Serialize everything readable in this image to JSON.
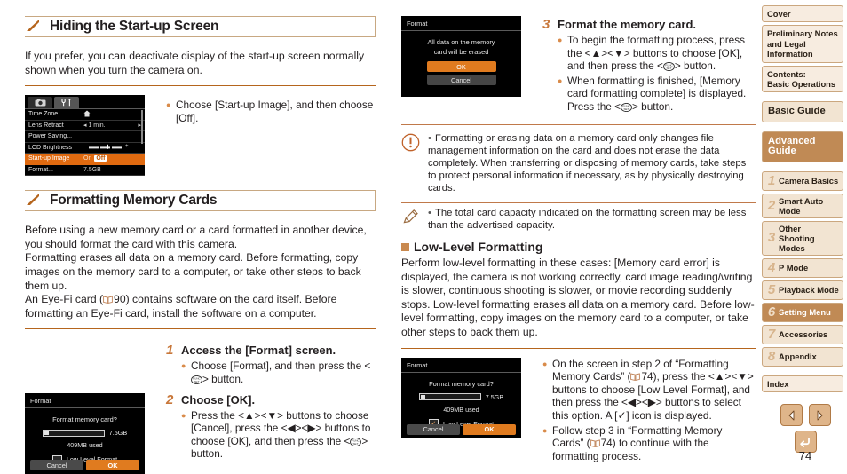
{
  "page": {
    "number": "74"
  },
  "left_column": {
    "section1": {
      "heading": "Hiding the Start-up Screen",
      "intro": "If you prefer, you can deactivate display of the start-up screen normally shown when you turn the camera on.",
      "screen": {
        "tabs": [
          "camera-icon",
          "wrench-tools-icon"
        ],
        "rows": [
          {
            "label": "Time Zone...",
            "value": "home-icon"
          },
          {
            "label": "Lens Retract",
            "value": "1 min."
          },
          {
            "label": "Power Saving...",
            "value": ""
          },
          {
            "label": "LCD Brightness",
            "value": "slider"
          },
          {
            "label": "Start-up Image",
            "value_on": "On",
            "value_off": "Off",
            "selected": true
          },
          {
            "label": "Format...",
            "value": "7.5GB"
          }
        ]
      },
      "bullets": [
        "Choose [Start-up Image], and then choose [Off]."
      ]
    },
    "section2": {
      "heading": "Formatting Memory Cards",
      "paragraphs": [
        "Before using a new memory card or a card formatted in another device, you should format the card with this camera.",
        "Formatting erases all data on a memory card. Before formatting, copy images on the memory card to a computer, or take other steps to back them up.",
        "An Eye-Fi card (—90) contains software on the card itself. Before formatting an Eye-Fi card, install the software on a computer."
      ],
      "eyefi_page_ref": "90",
      "step1": {
        "number": "1",
        "title": "Access the [Format] screen.",
        "bullets": [
          {
            "pre": "Choose [Format], and then press the <",
            "post": "> button."
          }
        ]
      },
      "step2": {
        "number": "2",
        "title": "Choose [OK].",
        "bullets": [
          {
            "pre": "Press the <▲><▼> buttons to choose [Cancel], press the <◀><▶> buttons to choose [OK], and then press the <",
            "post": "> button."
          }
        ]
      },
      "format_screen": {
        "title": "Format",
        "question": "Format memory card?",
        "capacity": "7.5GB",
        "used": "409MB used",
        "low_level_label": "Low Level Format",
        "low_level_checked": false,
        "cancel": "Cancel",
        "ok": "OK"
      }
    }
  },
  "mid_column": {
    "confirm_screen": {
      "title": "Format",
      "line1": "All data on the memory",
      "line2": "card will be erased",
      "ok": "OK",
      "cancel": "Cancel"
    },
    "step3": {
      "number": "3",
      "title": "Format the memory card.",
      "bullets": [
        {
          "pre": "To begin the formatting process, press the <▲><▼> buttons to choose [OK], and then press the <",
          "post": "> button."
        },
        {
          "pre": "When formatting is finished, [Memory card formatting complete] is displayed. Press the <",
          "post": "> button."
        }
      ]
    },
    "warning": {
      "icon": "exclamation-circle-icon",
      "text": "Formatting or erasing data on a memory card only changes file management information on the card and does not erase the data completely. When transferring or disposing of memory cards, take steps to protect personal information if necessary, as by physically destroying cards."
    },
    "note": {
      "icon": "pencil-icon",
      "text": "The total card capacity indicated on the formatting screen may be less than the advertised capacity."
    },
    "lowlevel": {
      "heading": "Low-Level Formatting",
      "paragraph": "Perform low-level formatting in these cases: [Memory card error] is displayed, the camera is not working correctly, card image reading/writing is slower, continuous shooting is slower, or movie recording suddenly stops. Low-level formatting erases all data on a memory card. Before low-level formatting, copy images on the memory card to a computer, or take other steps to back them up.",
      "screen": {
        "title": "Format",
        "question": "Format memory card?",
        "capacity": "7.5GB",
        "used": "409MB used",
        "low_level_label": "Low Level Format",
        "low_level_checked": true,
        "cancel": "Cancel",
        "ok": "OK"
      },
      "bullets": [
        {
          "part1": "On the screen in step 2 of “Formatting Memory Cards” (",
          "page_ref": "74",
          "part2": "), press the <▲><▼> buttons to choose [Low Level Format], and then press the <◀><▶> buttons to select this option. A [✓] icon is displayed."
        },
        {
          "part1": "Follow step 3 in “Formatting Memory Cards” (",
          "page_ref": "74",
          "part2": ") to continue with the formatting process."
        }
      ]
    }
  },
  "sidebar": {
    "items": [
      {
        "label": "Cover",
        "type": "plain"
      },
      {
        "label": "Preliminary Notes and Legal Information",
        "type": "plain"
      },
      {
        "label": "Contents:\nBasic Operations",
        "type": "plain"
      },
      {
        "label": "Basic Guide",
        "type": "big"
      },
      {
        "label": "Advanced Guide",
        "type": "big"
      },
      {
        "number": "1",
        "label": "Camera Basics",
        "type": "numbered"
      },
      {
        "number": "2",
        "label": "Smart Auto Mode",
        "type": "numbered"
      },
      {
        "number": "3",
        "label": "Other Shooting Modes",
        "type": "numbered"
      },
      {
        "number": "4",
        "label": "P Mode",
        "type": "numbered"
      },
      {
        "number": "5",
        "label": "Playback Mode",
        "type": "numbered"
      },
      {
        "number": "6",
        "label": "Setting Menu",
        "type": "numbered",
        "current": true
      },
      {
        "number": "7",
        "label": "Accessories",
        "type": "numbered"
      },
      {
        "number": "8",
        "label": "Appendix",
        "type": "numbered"
      },
      {
        "label": "Index",
        "type": "plain"
      }
    ],
    "labels": {
      "cover": "Cover",
      "prelim": "Preliminary Notes and Legal Information",
      "contents_l1": "Contents:",
      "contents_l2": "Basic Operations",
      "basic_guide": "Basic Guide",
      "advanced_guide": "Advanced Guide",
      "ch1": "Camera Basics",
      "ch2_l1": "Smart Auto",
      "ch2_l2": "Mode",
      "ch3_l1": "Other Shooting",
      "ch3_l2": "Modes",
      "ch4": "P Mode",
      "ch5": "Playback Mode",
      "ch6": "Setting Menu",
      "ch7": "Accessories",
      "ch8": "Appendix",
      "index": "Index",
      "n1": "1",
      "n2": "2",
      "n3": "3",
      "n4": "4",
      "n5": "5",
      "n6": "6",
      "n7": "7",
      "n8": "8"
    }
  },
  "nav": {
    "prev": "previous-page-icon",
    "next": "next-page-icon",
    "back": "return-icon"
  }
}
